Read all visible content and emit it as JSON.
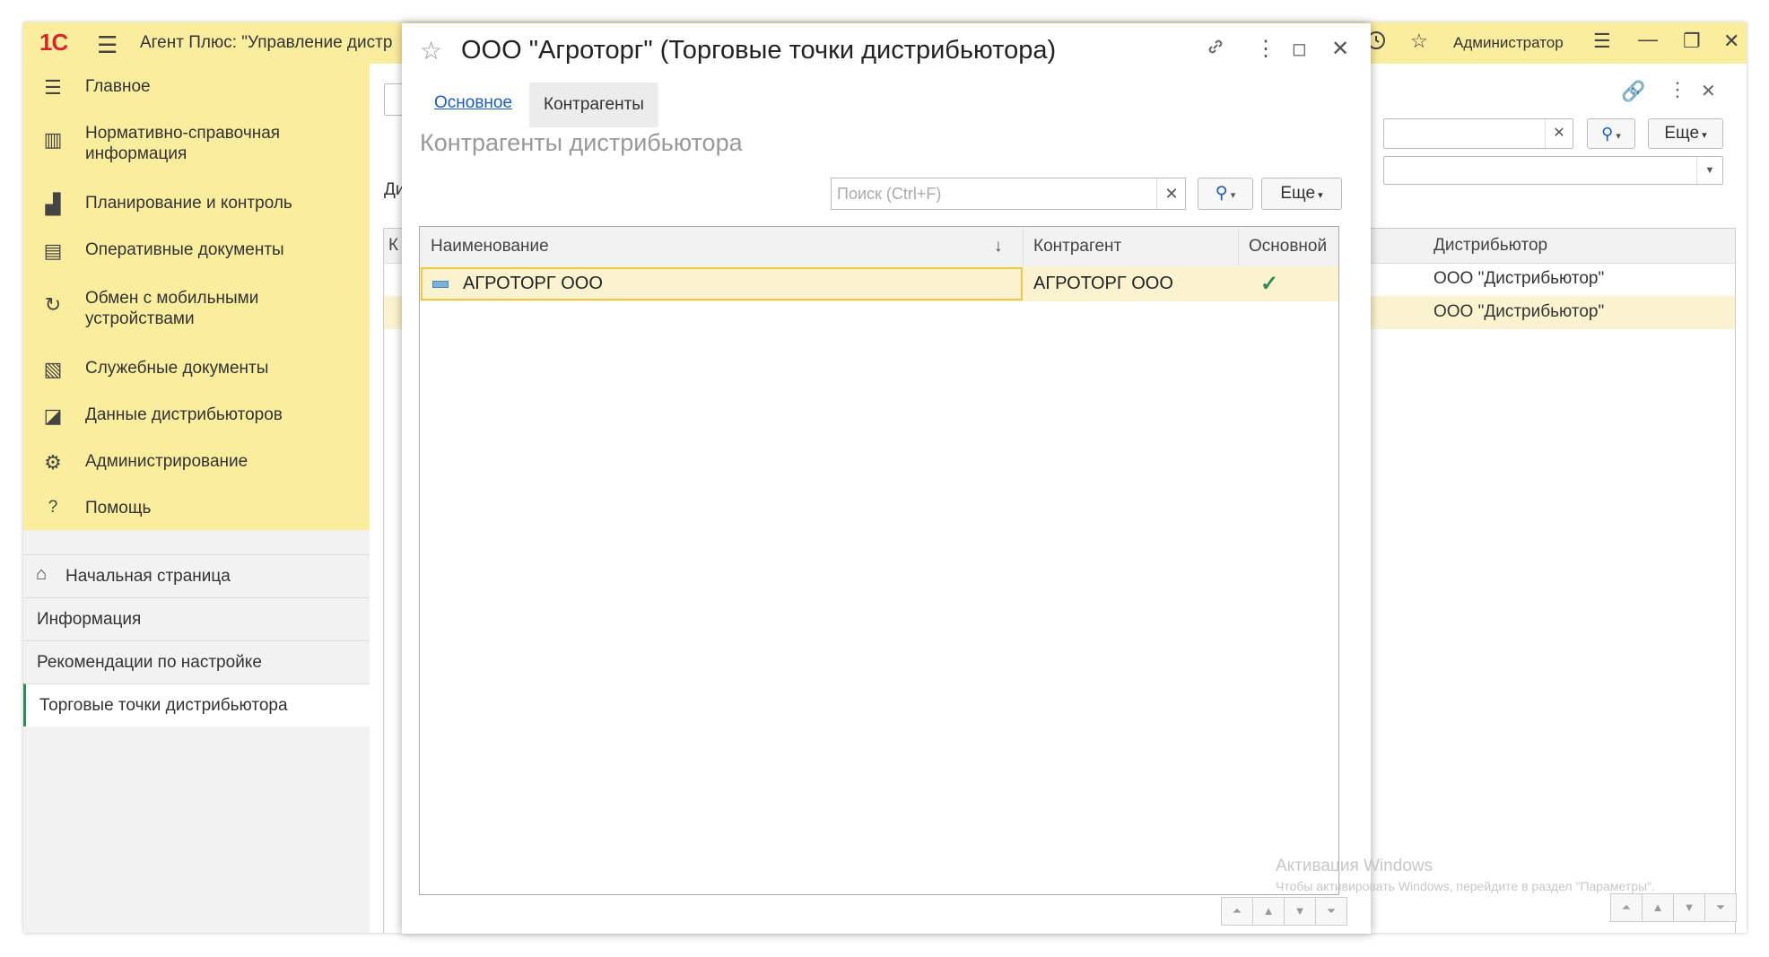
{
  "app": {
    "logo": "1С",
    "title": "Агент Плюс: \"Управление дистр",
    "user": "Администратор",
    "colors": {
      "accent_yellow": "#fbed9e",
      "logo_red": "#d7262b",
      "link_blue": "#1c5db3",
      "check_green": "#2e8b57",
      "selected_row": "#fbf3d0"
    }
  },
  "sidebar": {
    "menu": [
      {
        "icon": "hamburger-icon",
        "label": "Главное"
      },
      {
        "icon": "catalog-icon",
        "label": "Нормативно-справочная информация"
      },
      {
        "icon": "chart-icon",
        "label": "Планирование и контроль"
      },
      {
        "icon": "documents-icon",
        "label": "Оперативные документы"
      },
      {
        "icon": "sync-icon",
        "label": "Обмен с мобильными устройствами"
      },
      {
        "icon": "service-docs-icon",
        "label": "Служебные документы"
      },
      {
        "icon": "distributor-data-icon",
        "label": "Данные дистрибьюторов"
      },
      {
        "icon": "gear-icon",
        "label": "Администрирование"
      },
      {
        "icon": "help-icon",
        "label": "Помощь"
      }
    ],
    "nav": [
      {
        "label": "Начальная страница",
        "icon": "home-icon"
      },
      {
        "label": "Информация"
      },
      {
        "label": "Рекомендации по настройке"
      },
      {
        "label": "Торговые точки дистрибьютора",
        "active": true
      }
    ]
  },
  "background": {
    "more_label": "Еще",
    "column_header": "Дистрибьютор",
    "partial_label_1": "Ди",
    "partial_label_2": "К",
    "rows": [
      "ООО \"Дистрибьютор\"",
      "ООО \"Дистрибьютор\""
    ]
  },
  "modal": {
    "title": "ООО \"Агроторг\" (Торговые точки дистрибьютора)",
    "tabs": {
      "main": "Основное",
      "contractors": "Контрагенты"
    },
    "subtitle": "Контрагенты дистрибьютора",
    "search_placeholder": "Поиск (Ctrl+F)",
    "more_label": "Еще",
    "table": {
      "headers": {
        "name": "Наименование",
        "sort": "↓",
        "contractor": "Контрагент",
        "main": "Основной"
      },
      "rows": [
        {
          "name": "АГРОТОРГ ООО",
          "contractor": "АГРОТОРГ ООО",
          "main": "✓"
        }
      ]
    }
  },
  "watermark": {
    "line1": "Активация Windows",
    "line2": "Чтобы активировать Windows, перейдите в раздел \"Параметры\"."
  }
}
